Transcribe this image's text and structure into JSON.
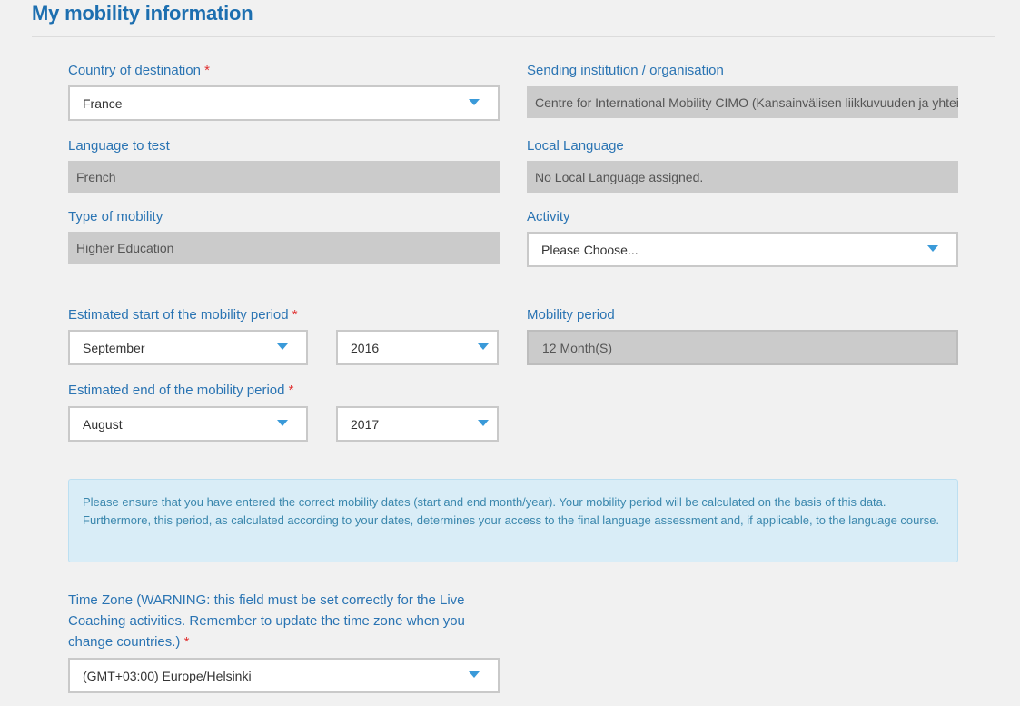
{
  "header": {
    "title": "My mobility information"
  },
  "fields": {
    "country": {
      "label": "Country of destination",
      "required": "*",
      "value": "France"
    },
    "sending": {
      "label": "Sending institution / organisation",
      "value": "Centre for International Mobility CIMO (Kansainvälisen liikkuvuuden ja yhteistyön keskus CIMO)"
    },
    "language": {
      "label": "Language to test",
      "value": "French"
    },
    "local_language": {
      "label": "Local Language",
      "value": "No Local Language assigned."
    },
    "mobility_type": {
      "label": "Type of mobility",
      "value": "Higher Education"
    },
    "activity": {
      "label": "Activity",
      "value": "Please Choose..."
    },
    "start": {
      "label": "Estimated start of the mobility period",
      "required": "*",
      "month": "September",
      "year": "2016"
    },
    "period": {
      "label": "Mobility period",
      "value": "12 Month(S)"
    },
    "end": {
      "label": "Estimated end of the mobility period",
      "required": "*",
      "month": "August",
      "year": "2017"
    },
    "timezone": {
      "label": "Time Zone (WARNING: this field must be set correctly for the Live Coaching activities. Remember to update the time zone when you change countries.)",
      "required": "*",
      "value": "(GMT+03:00) Europe/Helsinki"
    }
  },
  "notice": {
    "text": "Please ensure that you have entered the correct mobility dates (start and end month/year). Your mobility period will be calculated on the basis of this data. Furthermore, this period, as calculated according to your dates, determines your access to the final language assessment and, if applicable, to the language course."
  },
  "colors": {
    "accent": "#1d6fb0",
    "required": "#e03030",
    "arrow": "#3a9ad9",
    "notice_bg": "#d9edf7"
  },
  "icons": {
    "dropdown": "chevron-down-icon"
  }
}
